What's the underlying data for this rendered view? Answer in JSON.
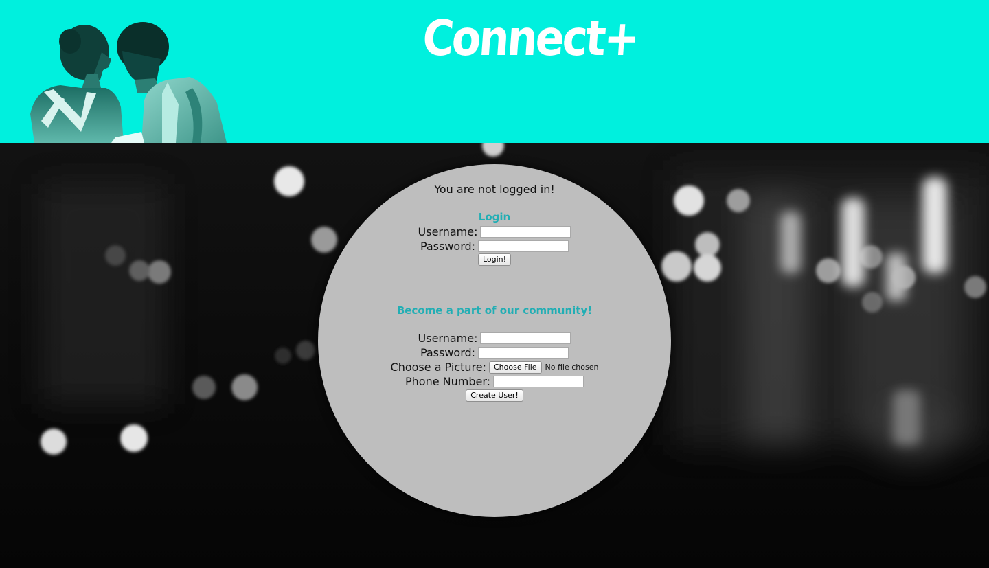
{
  "colors": {
    "header_bg": "#00f0de",
    "panel_bg": "#bebebe",
    "accent": "#21aeb4",
    "photo_tint": "#0d4c45"
  },
  "header": {
    "logo": "Connect+",
    "photo_icon": "couple-silhouette-photo"
  },
  "status": {
    "message": "You are not logged in!"
  },
  "login": {
    "title": "Login",
    "username_label": "Username:",
    "password_label": "Password:",
    "username_value": "",
    "password_value": "",
    "submit_label": "Login!"
  },
  "register": {
    "title": "Become a part of our community!",
    "username_label": "Username:",
    "password_label": "Password:",
    "picture_label": "Choose a Picture:",
    "choose_file_label": "Choose File",
    "file_status": "No file chosen",
    "phone_label": "Phone Number:",
    "username_value": "",
    "password_value": "",
    "phone_value": "",
    "submit_label": "Create User!"
  }
}
